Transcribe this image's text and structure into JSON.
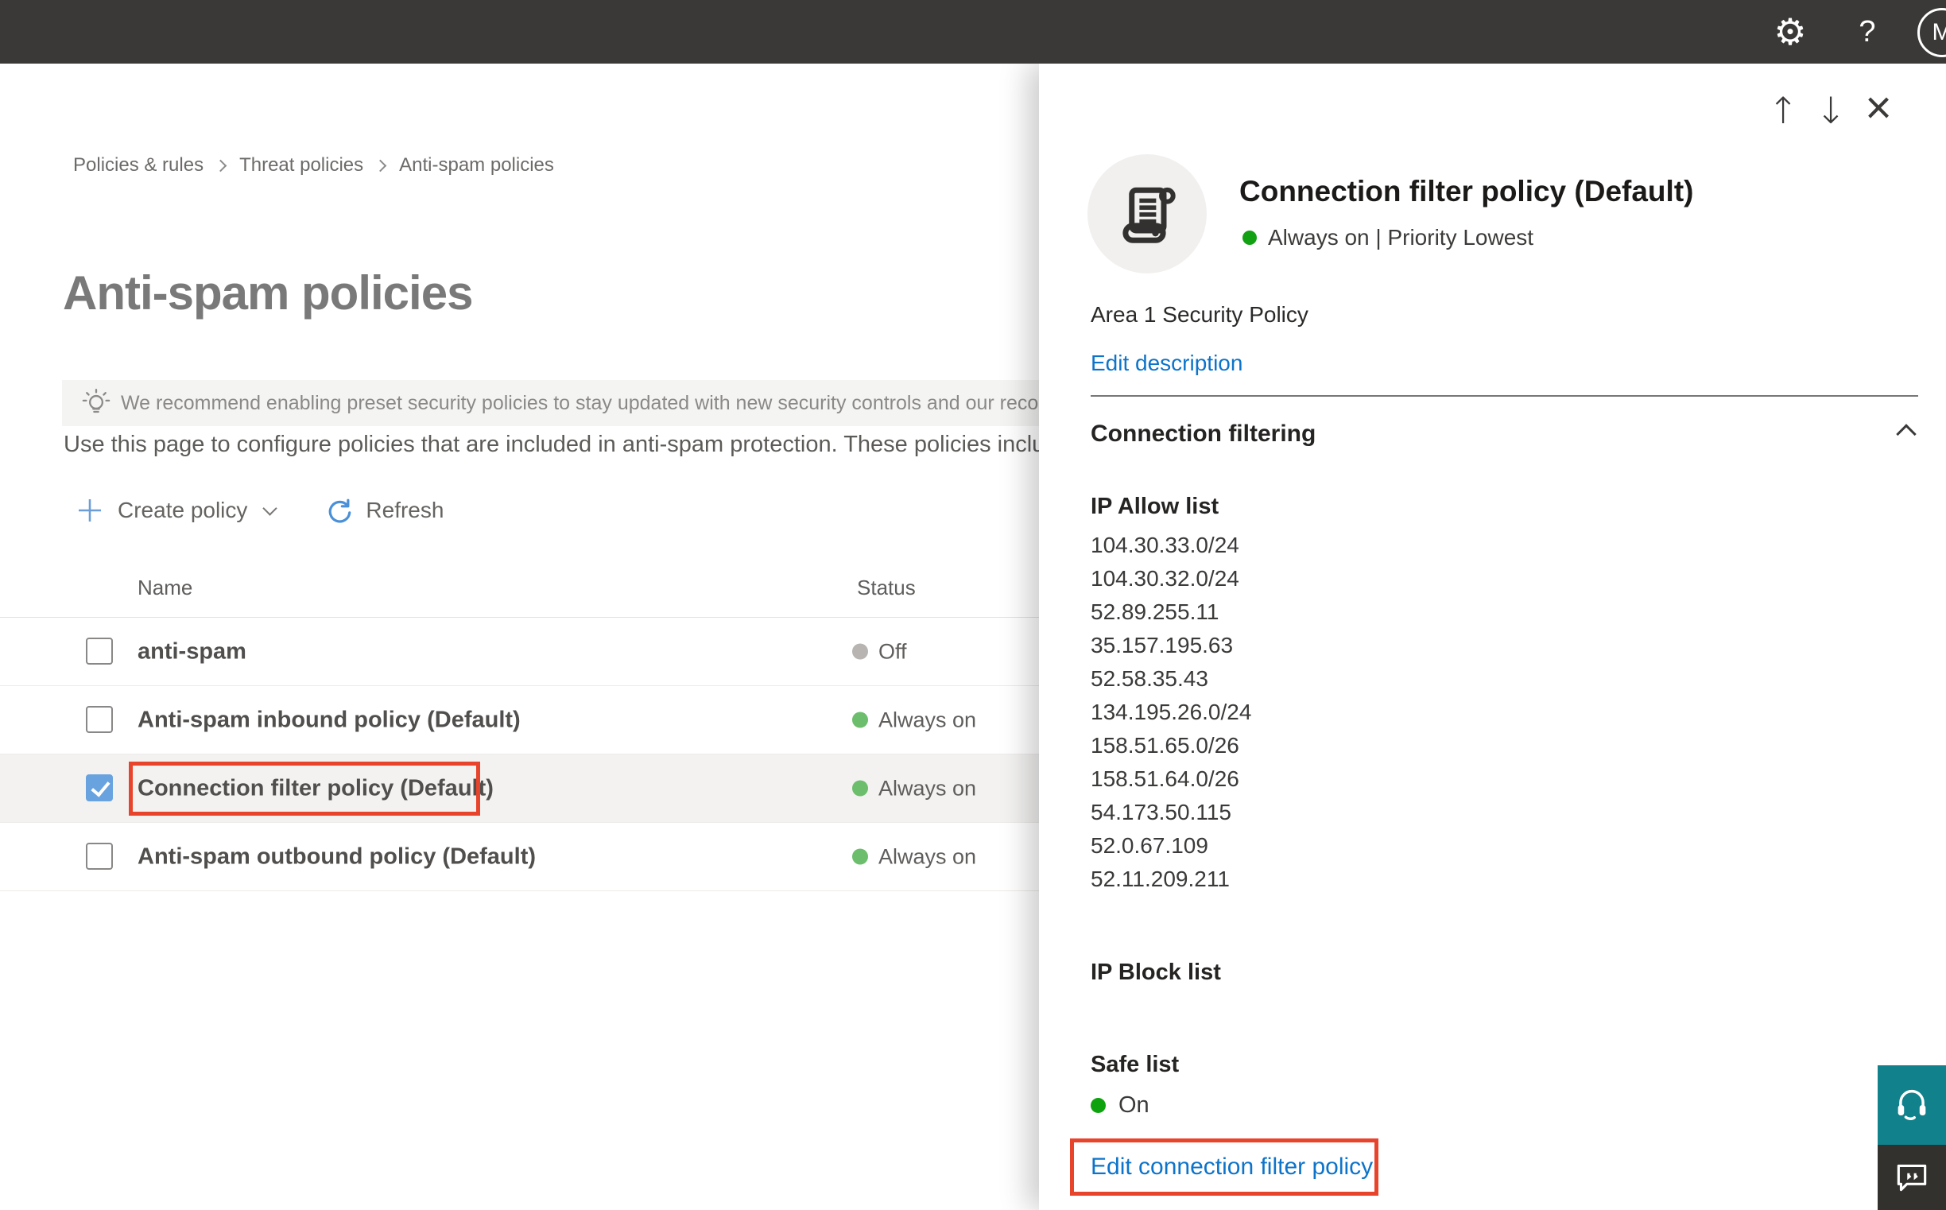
{
  "colors": {
    "topbar_bg": "#3a3937",
    "accent_blue": "#0d74ca",
    "checkbox_blue": "#68a3e0",
    "status_green": "#6cbe6c",
    "panel_status_green": "#12a112",
    "status_gray": "#b7b4b1",
    "highlight_red": "#e8432b",
    "help_button_teal": "#11818b",
    "feedback_button_dark": "#33312e"
  },
  "topbar": {
    "gear_icon": "⚙",
    "help_icon": "?",
    "avatar_initial": "M"
  },
  "breadcrumb": {
    "items": [
      "Policies & rules",
      "Threat policies",
      "Anti-spam policies"
    ]
  },
  "main": {
    "title": "Anti-spam policies",
    "banner_text": "We recommend enabling preset security policies to stay updated with new security controls and our recomme",
    "description": "Use this page to configure policies that are included in anti-spam protection. These policies include",
    "toolbar": {
      "create_policy_label": "Create policy",
      "refresh_label": "Refresh"
    },
    "table": {
      "columns": [
        "Name",
        "Status"
      ],
      "rows": [
        {
          "name": "anti-spam",
          "status": "Off",
          "checked": false,
          "selected": false
        },
        {
          "name": "Anti-spam inbound policy (Default)",
          "status": "Always on",
          "checked": false,
          "selected": false
        },
        {
          "name": "Connection filter policy (Default)",
          "status": "Always on",
          "checked": true,
          "selected": true
        },
        {
          "name": "Anti-spam outbound policy (Default)",
          "status": "Always on",
          "checked": false,
          "selected": false
        }
      ]
    }
  },
  "panel": {
    "nav": {
      "up_icon": "↑",
      "down_icon": "↓",
      "close_icon": "×"
    },
    "title": "Connection filter policy (Default)",
    "status_text": "Always on | Priority Lowest",
    "description": "Area 1 Security Policy",
    "edit_description_label": "Edit description",
    "section": {
      "title": "Connection filtering",
      "ip_allow_title": "IP Allow list",
      "ip_allow": [
        "104.30.33.0/24",
        "104.30.32.0/24",
        "52.89.255.11",
        "35.157.195.63",
        "52.58.35.43",
        "134.195.26.0/24",
        "158.51.65.0/26",
        "158.51.64.0/26",
        "54.173.50.115",
        "52.0.67.109",
        "52.11.209.211"
      ],
      "ip_block_title": "IP Block list",
      "safe_list_title": "Safe list",
      "safe_list_status": "On",
      "edit_link_label": "Edit connection filter policy"
    }
  }
}
